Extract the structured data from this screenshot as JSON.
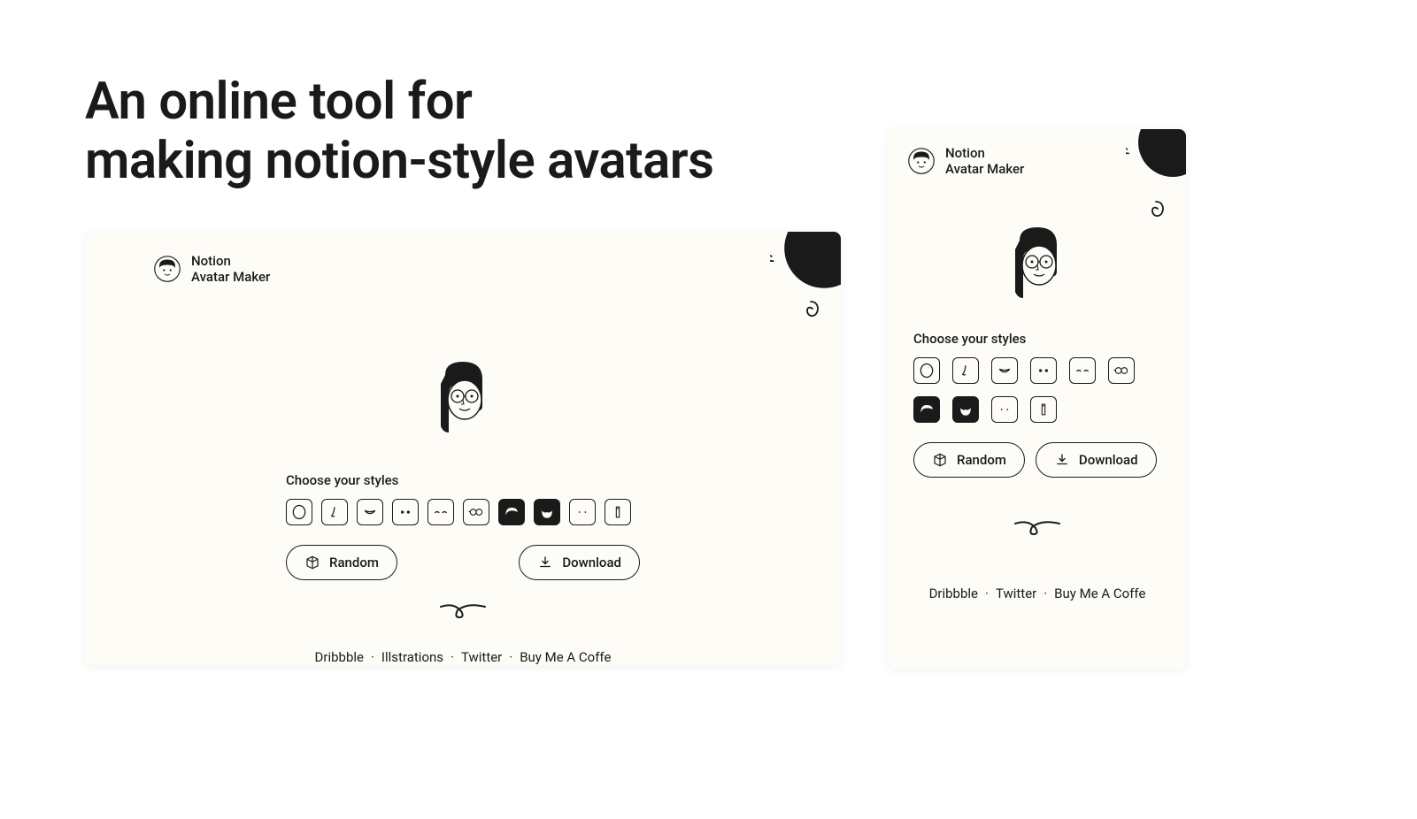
{
  "headline_line1": "An online tool for",
  "headline_line2": "making notion-style avatars",
  "logo": {
    "line1": "Notion",
    "line2": "Avatar Maker"
  },
  "styles_label": "Choose your styles",
  "style_tiles": [
    {
      "name": "face-shape",
      "selected": false
    },
    {
      "name": "nose",
      "selected": false
    },
    {
      "name": "mouth",
      "selected": false
    },
    {
      "name": "eyes",
      "selected": false
    },
    {
      "name": "eyebrows",
      "selected": false
    },
    {
      "name": "glasses",
      "selected": false
    },
    {
      "name": "hair",
      "selected": true
    },
    {
      "name": "beard",
      "selected": true
    },
    {
      "name": "details",
      "selected": false
    },
    {
      "name": "accessories",
      "selected": false
    }
  ],
  "buttons": {
    "random": "Random",
    "download": "Download"
  },
  "footer": {
    "desktop": [
      "Dribbble",
      "Illstrations",
      "Twitter",
      "Buy Me A Coffe"
    ],
    "mobile": [
      "Dribbble",
      "Twitter",
      "Buy Me A Coffe"
    ]
  }
}
